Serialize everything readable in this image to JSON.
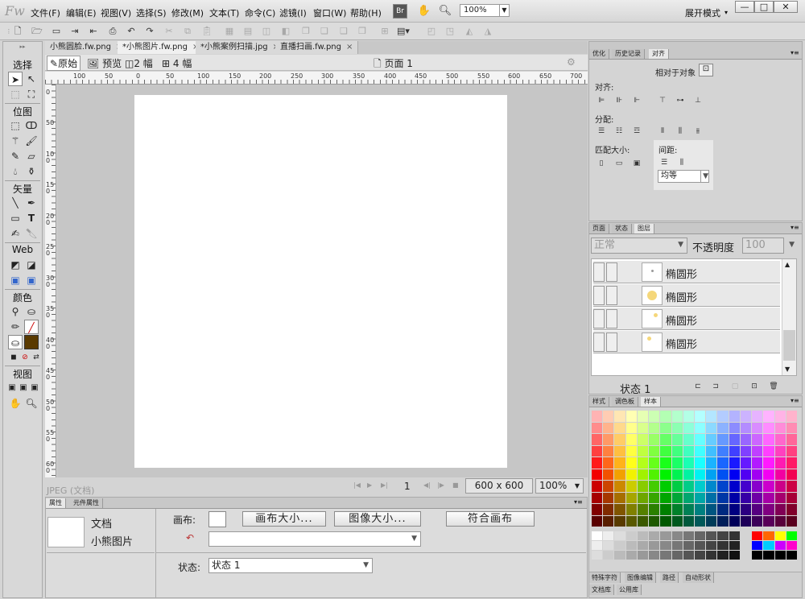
{
  "app": {
    "logo": "Fw",
    "workspace": "展开模式"
  },
  "menu": [
    "文件(F)",
    "编辑(E)",
    "视图(V)",
    "选择(S)",
    "修改(M)",
    "文本(T)",
    "命令(C)",
    "滤镜(I)",
    "窗口(W)",
    "帮助(H)"
  ],
  "top": {
    "bridge": "Br",
    "zoom": "100%",
    "win_min": "—",
    "win_max": "□",
    "win_close": "✕"
  },
  "tools": {
    "select": "选择",
    "bitmap": "位图",
    "vector": "矢量",
    "web": "Web",
    "colors": "颜色",
    "view": "视图"
  },
  "doc_tabs": [
    {
      "label": "小熊圆脸.fw.png",
      "active": false
    },
    {
      "label": "*小熊图片.fw.png",
      "active": true
    },
    {
      "label": "*小熊案例扫描.jpg",
      "active": false
    },
    {
      "label": "直播扫画.fw.png",
      "active": false
    }
  ],
  "viewbar": {
    "original": "原始",
    "preview": "预览",
    "two_up": "2 幅",
    "four_up": "4 幅",
    "page": "页面 1"
  },
  "ruler": {
    "h_labels": [
      "100",
      "50",
      "0",
      "50",
      "100",
      "150",
      "200",
      "250",
      "300",
      "350",
      "400",
      "450",
      "500",
      "550",
      "600",
      "650",
      "700"
    ],
    "v_labels": [
      "0",
      "50",
      "100",
      "150",
      "200",
      "250",
      "300",
      "350",
      "400",
      "450",
      "500",
      "550",
      "600"
    ]
  },
  "status": {
    "format": "JPEG (文档)",
    "frame": "1",
    "size": "600 x 600",
    "zoom": "100%"
  },
  "props": {
    "tab1": "属性",
    "tab2": "元件属性",
    "doc_label": "文档",
    "doc_name": "小熊图片",
    "canvas_label": "画布:",
    "canvas_size_btn": "画布大小...",
    "image_size_btn": "图像大小...",
    "fit_canvas_btn": "符合画布",
    "state_label": "状态:",
    "state_value": "状态 1"
  },
  "align_panel": {
    "tabs": [
      "优化",
      "历史记录",
      "对齐"
    ],
    "relative": "相对于对象",
    "align": "对齐:",
    "distribute": "分配:",
    "match_size": "匹配大小:",
    "spacing": "间距:",
    "spacing_value": "均等"
  },
  "layers_panel": {
    "tabs": [
      "页面",
      "状态",
      "图层"
    ],
    "blend": "正常",
    "opacity_label": "不透明度",
    "opacity_value": "100",
    "layers": [
      "椭圆形",
      "椭圆形",
      "椭圆形",
      "椭圆形"
    ],
    "state": "状态 1"
  },
  "swatch_panel": {
    "tabs": [
      "样式",
      "调色板",
      "样本"
    ]
  },
  "bottom_tabs": [
    "特殊字符",
    "图像编辑",
    "路径",
    "自动形状",
    "文档库",
    "公用库"
  ]
}
